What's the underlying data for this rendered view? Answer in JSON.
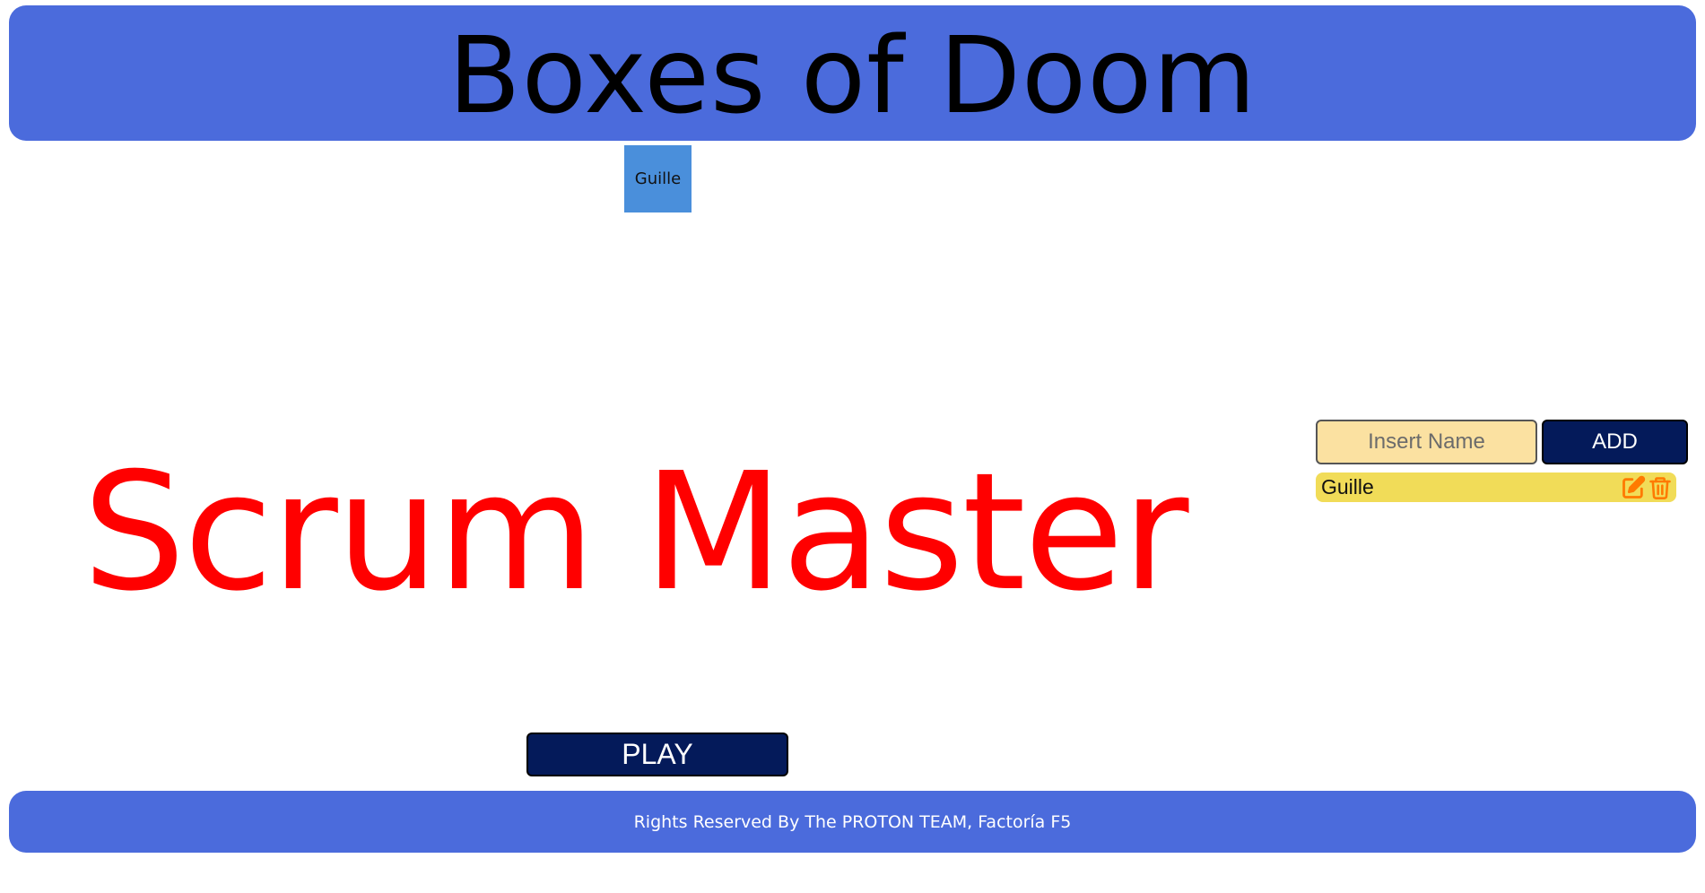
{
  "header": {
    "title": "Boxes of Doom"
  },
  "board": {
    "boxes": [
      {
        "label": "Guille"
      }
    ]
  },
  "result": {
    "role": "Scrum Master"
  },
  "controls": {
    "play_label": "PLAY"
  },
  "sidebar": {
    "input_placeholder": "Insert Name",
    "input_value": "",
    "add_label": "ADD",
    "players": [
      {
        "name": "Guille"
      }
    ]
  },
  "footer": {
    "text": "Rights Reserved By The PROTON TEAM, Factoría F5"
  },
  "colors": {
    "header_bg": "#4b6bdc",
    "box_bg": "#4a8fdb",
    "role_text": "#ff0000",
    "button_bg": "#041a5a",
    "input_bg": "#fbe1a1",
    "player_item_bg": "#f1dc58",
    "icon_color": "#ff7a00"
  },
  "icons": {
    "edit": "edit-icon",
    "delete": "trash-icon"
  }
}
